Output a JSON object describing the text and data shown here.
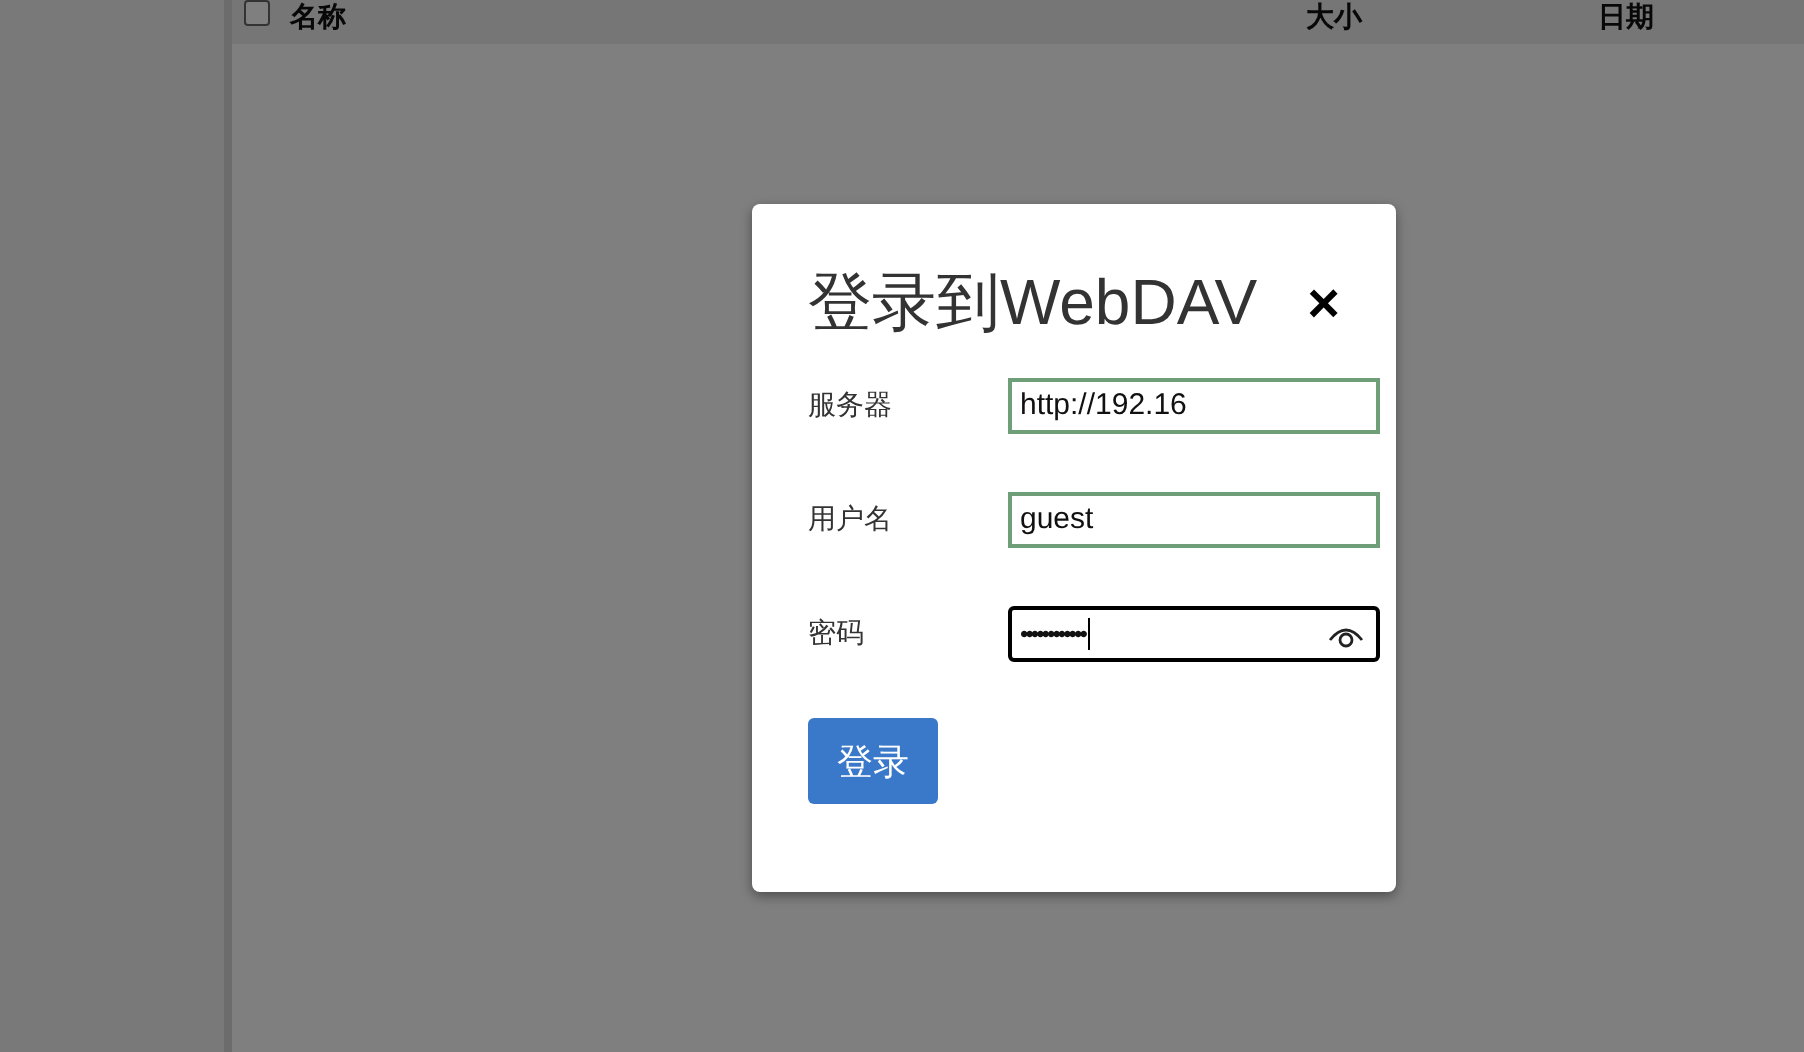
{
  "table": {
    "columns": [
      {
        "label": "名称"
      },
      {
        "label": "大小"
      },
      {
        "label": "日期"
      }
    ],
    "select_all_checked": false
  },
  "dialog": {
    "title": "登录到WebDAV",
    "close": "×",
    "fields": [
      {
        "label": "服务器",
        "value": "http://192.16",
        "kind": "text",
        "focused": false
      },
      {
        "label": "用户名",
        "value": "guest",
        "kind": "text",
        "focused": false
      },
      {
        "label": "密码",
        "value": "••••••••••••",
        "kind": "password",
        "focused": true
      }
    ],
    "submit": "登录"
  }
}
